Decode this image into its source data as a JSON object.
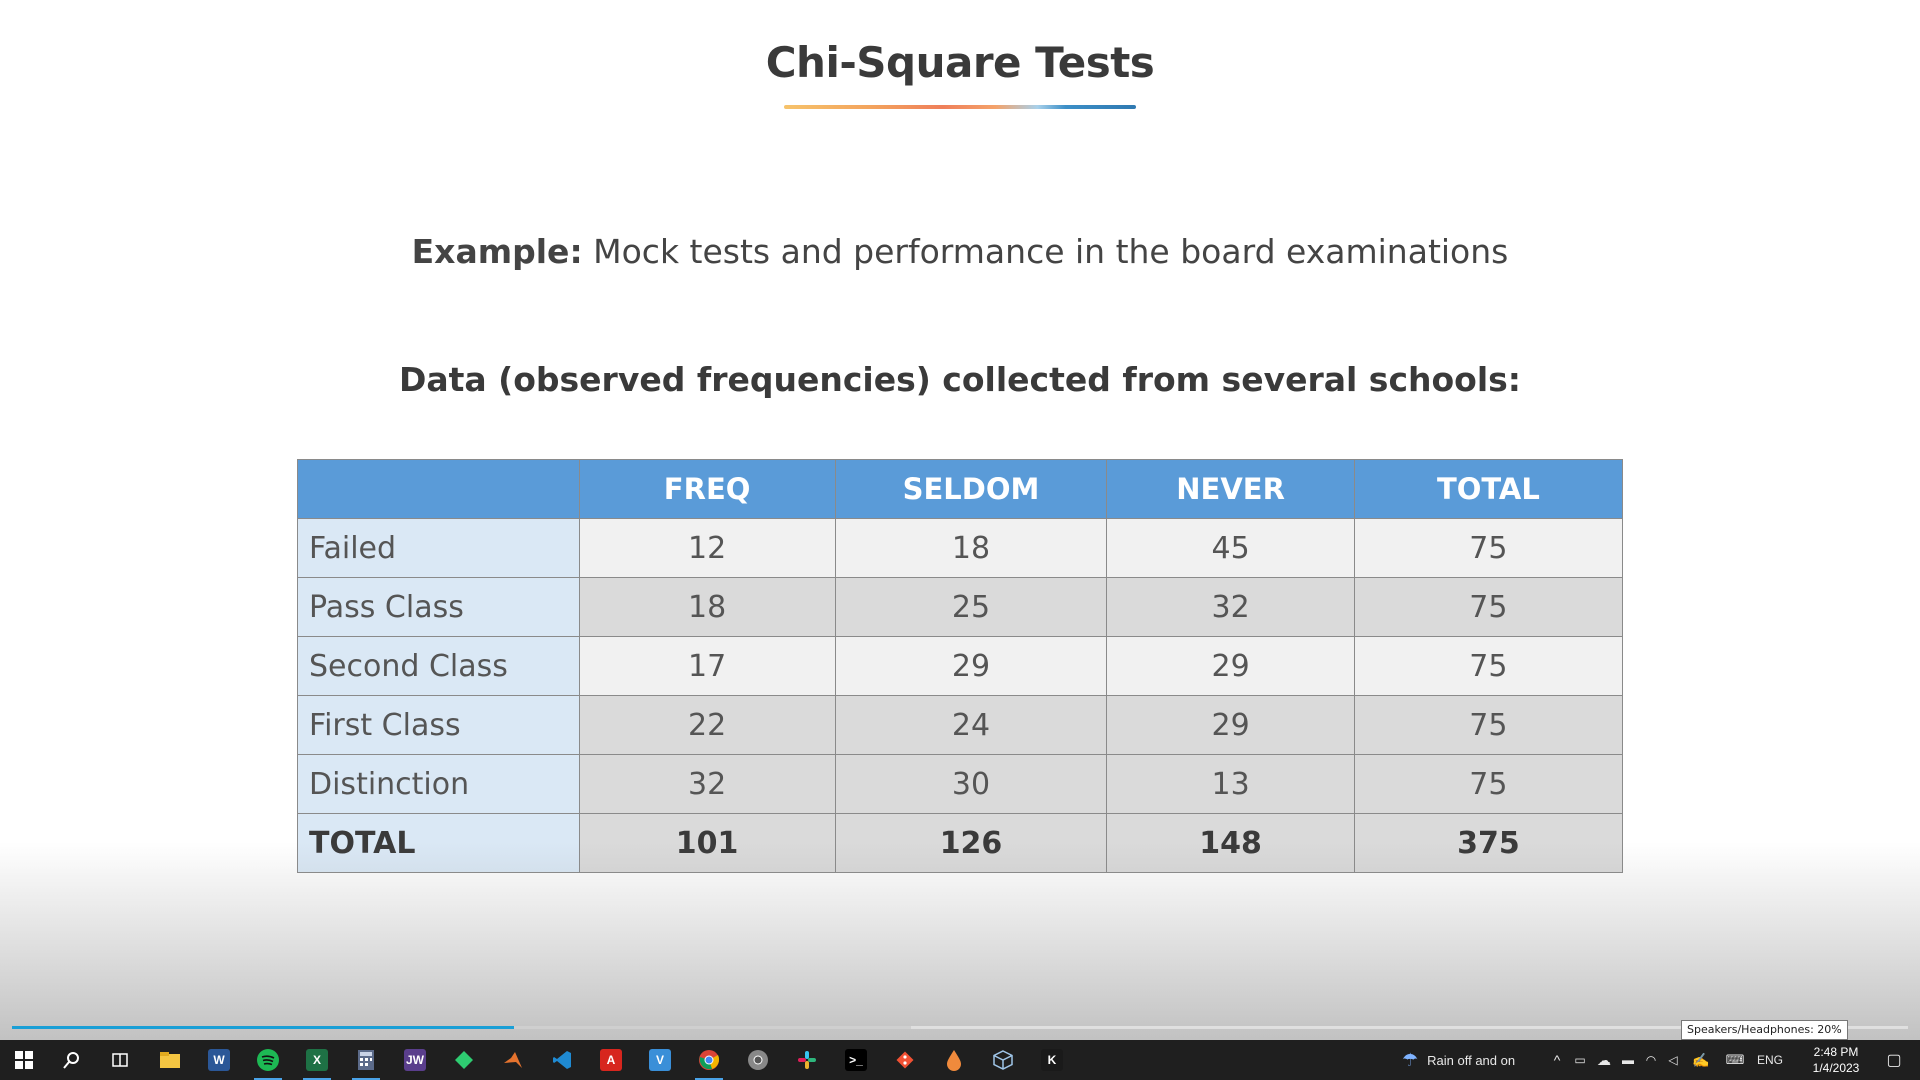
{
  "slide": {
    "title": "Chi-Square Tests",
    "example_label": "Example:",
    "example_text": "Mock tests and performance in the board examinations",
    "subtitle": "Data (observed frequencies) collected from several schools:",
    "table": {
      "headers": [
        "",
        "FREQ",
        "SELDOM",
        "NEVER",
        "TOTAL"
      ],
      "rows": [
        {
          "label": "Failed",
          "values": [
            "12",
            "18",
            "45",
            "75"
          ]
        },
        {
          "label": "Pass Class",
          "values": [
            "18",
            "25",
            "32",
            "75"
          ]
        },
        {
          "label": "Second Class",
          "values": [
            "17",
            "29",
            "29",
            "75"
          ]
        },
        {
          "label": "First Class",
          "values": [
            "22",
            "24",
            "29",
            "75"
          ]
        },
        {
          "label": "Distinction",
          "values": [
            "32",
            "30",
            "13",
            "75"
          ]
        }
      ],
      "total": {
        "label": "TOTAL",
        "values": [
          "101",
          "126",
          "148",
          "375"
        ]
      }
    }
  },
  "player": {
    "progress_fraction": 0.265,
    "volume_tooltip": "Speakers/Headphones: 20%"
  },
  "taskbar": {
    "apps": [
      {
        "name": "windows-start-icon",
        "glyph": "",
        "color": "#ffffff",
        "active": false
      },
      {
        "name": "search-icon",
        "glyph": "",
        "color": "#ffffff",
        "active": false
      },
      {
        "name": "task-view-icon",
        "glyph": "",
        "color": "#ffffff",
        "active": false
      },
      {
        "name": "file-explorer-icon",
        "glyph": "",
        "color": "#f4c542",
        "active": false
      },
      {
        "name": "word-icon",
        "glyph": "W",
        "color": "#2b5797",
        "active": false
      },
      {
        "name": "spotify-icon",
        "glyph": "",
        "color": "#1db954",
        "active": true
      },
      {
        "name": "excel-icon",
        "glyph": "X",
        "color": "#1e7145",
        "active": true
      },
      {
        "name": "calculator-icon",
        "glyph": "",
        "color": "#5c6b8a",
        "active": true
      },
      {
        "name": "jw-app-icon",
        "glyph": "JW",
        "color": "#5a3e8c",
        "active": false
      },
      {
        "name": "kite-app-icon",
        "glyph": "",
        "color": "#2ecc71",
        "active": false
      },
      {
        "name": "matlab-icon",
        "glyph": "",
        "color": "#e5732e",
        "active": false
      },
      {
        "name": "vscode-icon",
        "glyph": "",
        "color": "#1f8ad2",
        "active": false
      },
      {
        "name": "acrobat-icon",
        "glyph": "A",
        "color": "#d7261e",
        "active": false
      },
      {
        "name": "vs-app-icon",
        "glyph": "V",
        "color": "#3a8fd8",
        "active": false
      },
      {
        "name": "chrome-icon",
        "glyph": "",
        "color": "#e6b822",
        "active": true
      },
      {
        "name": "chrome-dev-icon",
        "glyph": "",
        "color": "#6c8eaa",
        "active": false
      },
      {
        "name": "slack-icon",
        "glyph": "",
        "color": "#e01e5a",
        "active": false
      },
      {
        "name": "terminal-icon",
        "glyph": ">_",
        "color": "#000000",
        "active": false
      },
      {
        "name": "git-icon",
        "glyph": "",
        "color": "#f05033",
        "active": false
      },
      {
        "name": "paint-drop-icon",
        "glyph": "",
        "color": "#f08a3c",
        "active": false
      },
      {
        "name": "virtualbox-icon",
        "glyph": "",
        "color": "#6fa8dc",
        "active": false
      },
      {
        "name": "k-app-icon",
        "glyph": "K",
        "color": "#1a1a1a",
        "active": false
      }
    ],
    "weather": "Rain off and on",
    "language": "ENG",
    "time": "2:48 PM",
    "date": "1/4/2023"
  }
}
